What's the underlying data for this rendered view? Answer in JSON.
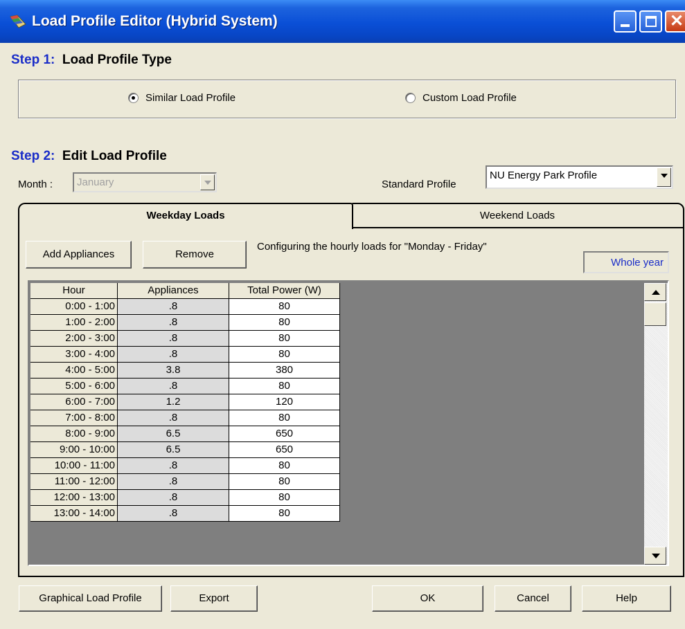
{
  "window": {
    "title": "Load Profile Editor (Hybrid System)",
    "controls": {
      "minimize": "minimize-icon",
      "maximize": "maximize-icon",
      "close": "close-icon"
    }
  },
  "step1": {
    "number": "Step 1:",
    "title": "Load Profile Type",
    "options": [
      {
        "label": "Similar Load Profile",
        "selected": true
      },
      {
        "label": "Custom Load Profile",
        "selected": false
      }
    ]
  },
  "step2": {
    "number": "Step 2:",
    "title": "Edit Load Profile",
    "month_label": "Month :",
    "month_value": "January",
    "standard_profile_label": "Standard Profile",
    "standard_profile_value": "NU Energy Park Profile"
  },
  "tabs": [
    {
      "label": "Weekday Loads",
      "active": true
    },
    {
      "label": "Weekend Loads",
      "active": false
    }
  ],
  "toolbar": {
    "add_label": "Add Appliances",
    "remove_label": "Remove",
    "info_text": "Configuring the hourly loads for \"Monday - Friday\"",
    "period_value": "Whole year"
  },
  "table": {
    "columns": [
      "Hour",
      "Appliances",
      "Total Power (W)"
    ],
    "rows": [
      [
        "0:00 - 1:00",
        ".8",
        "80"
      ],
      [
        "1:00 - 2:00",
        ".8",
        "80"
      ],
      [
        "2:00 - 3:00",
        ".8",
        "80"
      ],
      [
        "3:00 - 4:00",
        ".8",
        "80"
      ],
      [
        "4:00 - 5:00",
        "3.8",
        "380"
      ],
      [
        "5:00 - 6:00",
        ".8",
        "80"
      ],
      [
        "6:00 - 7:00",
        "1.2",
        "120"
      ],
      [
        "7:00 - 8:00",
        ".8",
        "80"
      ],
      [
        "8:00 - 9:00",
        "6.5",
        "650"
      ],
      [
        "9:00 - 10:00",
        "6.5",
        "650"
      ],
      [
        "10:00 - 11:00",
        ".8",
        "80"
      ],
      [
        "11:00 - 12:00",
        ".8",
        "80"
      ],
      [
        "12:00 - 13:00",
        ".8",
        "80"
      ],
      [
        "13:00 - 14:00",
        ".8",
        "80"
      ]
    ]
  },
  "footer": {
    "graphical_label": "Graphical Load Profile",
    "export_label": "Export",
    "ok_label": "OK",
    "cancel_label": "Cancel",
    "help_label": "Help"
  }
}
